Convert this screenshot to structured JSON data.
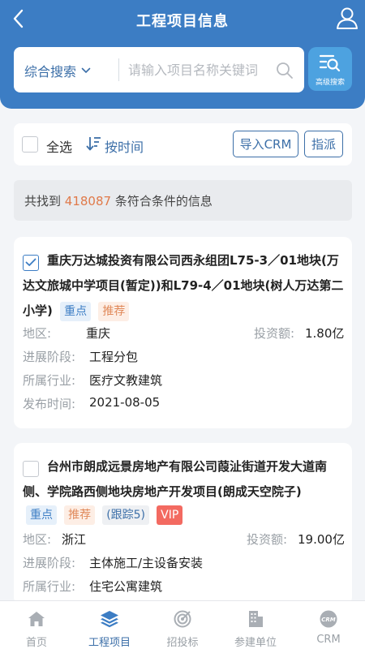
{
  "header": {
    "title": "工程项目信息"
  },
  "search": {
    "type_label": "综合搜索",
    "placeholder": "请输入项目名称关键词",
    "advanced_label": "高级搜索"
  },
  "toolbar": {
    "select_all": "全选",
    "sort_label": "按时间",
    "import_label": "导入CRM",
    "assign_label": "指派"
  },
  "result": {
    "prefix": "共找到",
    "count": "418087",
    "suffix": "条符合条件的信息"
  },
  "projects": [
    {
      "title": "重庆万达城投资有限公司西永组团L75-3／01地块(万达文旅城中学项目(暂定))和L79-4／01地块(树人万达第二小学)",
      "checked": true,
      "tags": [
        "重点",
        "推荐"
      ],
      "region_label": "地区:",
      "region": "重庆",
      "investment_label": "投资额:",
      "investment": "1.80亿",
      "stage_label": "进展阶段:",
      "stage": "工程分包",
      "industry_label": "所属行业:",
      "industry": "医疗文教建筑",
      "date_label": "发布时间:",
      "date": "2021-08-05"
    },
    {
      "title": "台州市朗成远景房地产有限公司葭沚街道开发大道南侧、学院路西侧地块房地产开发项目(朗成天空院子)",
      "checked": false,
      "tags": [
        "重点",
        "推荐",
        "(跟踪5)",
        "VIP"
      ],
      "region_label": "地区:",
      "region": "浙江",
      "investment_label": "投资额:",
      "investment": "19.00亿",
      "stage_label": "进展阶段:",
      "stage": "主体施工/主设备安装",
      "industry_label": "所属行业:",
      "industry": "住宅公寓建筑"
    }
  ],
  "nav": {
    "items": [
      {
        "label": "首页",
        "icon": "home-icon"
      },
      {
        "label": "工程项目",
        "icon": "layers-icon"
      },
      {
        "label": "招投标",
        "icon": "target-icon"
      },
      {
        "label": "参建单位",
        "icon": "building-icon"
      },
      {
        "label": "CRM",
        "icon": "crm-icon"
      }
    ],
    "active_index": 1
  },
  "colors": {
    "primary": "#3c7dc4",
    "link": "#3c6fa8",
    "accent": "#e07a4a",
    "vip": "#f36a61"
  }
}
